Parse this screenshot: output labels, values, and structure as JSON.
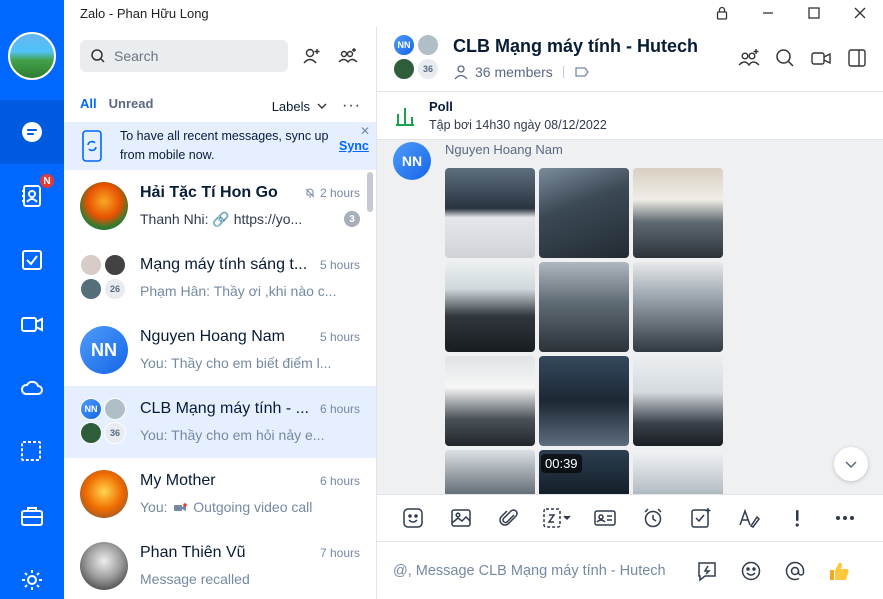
{
  "window": {
    "title": "Zalo - Phan Hữu Long"
  },
  "search": {
    "placeholder": "Search"
  },
  "tabs": {
    "all": "All",
    "unread": "Unread",
    "labels": "Labels",
    "more": "···"
  },
  "sync_banner": {
    "message": "To have all recent messages, sync up from mobile now.",
    "action": "Sync",
    "close": "✕"
  },
  "conversations": [
    {
      "name": "Hải Tặc Tí Hon Go",
      "time": "2 hours",
      "preview": "Thanh Nhi: 🔗 https://yo...",
      "unread": "3",
      "muted": true
    },
    {
      "name": "Mạng máy tính sáng t...",
      "time": "5 hours",
      "preview": "Phạm Hân: Thầy ơi ,khi nào c...",
      "member_count": "26"
    },
    {
      "name": "Nguyen Hoang Nam",
      "time": "5 hours",
      "preview": "You: Thầy cho em biết điểm l...",
      "initials": "NN"
    },
    {
      "name": "CLB Mạng máy tính - ...",
      "time": "6 hours",
      "preview": "You: Thầy cho em hỏi nảy e...",
      "member_count": "36",
      "initials": "NN"
    },
    {
      "name": "My Mother",
      "time": "6 hours",
      "preview_prefix": "You:",
      "preview": "Outgoing video call"
    },
    {
      "name": "Phan Thiên Vũ",
      "time": "7 hours",
      "preview": "Message recalled"
    }
  ],
  "chat": {
    "title": "CLB Mạng máy tính - Hutech",
    "members": "36 members",
    "avatar_initials": "NN",
    "avatar_count": "36",
    "poll_label": "Poll",
    "poll_text": "Tập bơi 14h30 ngày 08/12/2022",
    "sender_name": "Nguyen Hoang Nam",
    "sender_initials": "NN",
    "video_duration": "00:39",
    "composer_placeholder": "@, Message CLB Mạng máy tính - Hutech"
  },
  "colors": {
    "brand": "#0068ff",
    "rail_active": "#005ae0",
    "selected_row": "#e5efff",
    "badge_red": "#e53935"
  },
  "icons": {
    "rail": [
      "chat-icon",
      "contacts-icon",
      "todo-icon",
      "video-icon",
      "cloud-icon",
      "screenshot-icon",
      "briefcase-icon",
      "settings-icon"
    ],
    "toolbar": [
      "sticker-icon",
      "image-icon",
      "attachment-icon",
      "screenshot-icon",
      "business-card-icon",
      "reminder-icon",
      "task-icon",
      "text-format-icon",
      "urgent-icon",
      "more-icon"
    ],
    "composer": [
      "quick-message-icon",
      "emoji-icon",
      "mention-icon",
      "thumbs-up-icon"
    ]
  }
}
